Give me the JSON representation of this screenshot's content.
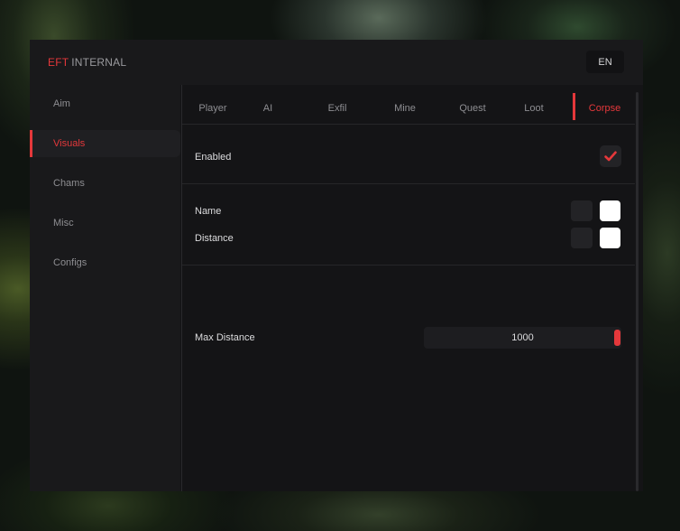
{
  "app": {
    "brand": "EFT",
    "title_rest": "INTERNAL",
    "language": "EN"
  },
  "sidebar": {
    "items": [
      {
        "label": "Aim",
        "active": false
      },
      {
        "label": "Visuals",
        "active": true
      },
      {
        "label": "Chams",
        "active": false
      },
      {
        "label": "Misc",
        "active": false
      },
      {
        "label": "Configs",
        "active": false
      }
    ]
  },
  "tabs": [
    {
      "label": "Player",
      "active": false
    },
    {
      "label": "AI",
      "active": false
    },
    {
      "label": "Exfil",
      "active": false
    },
    {
      "label": "Mine",
      "active": false
    },
    {
      "label": "Quest",
      "active": false
    },
    {
      "label": "Loot",
      "active": false
    },
    {
      "label": "Corpse",
      "active": true
    }
  ],
  "settings": {
    "enabled": {
      "label": "Enabled",
      "checked": true
    },
    "name": {
      "label": "Name",
      "color": "#ffffff"
    },
    "distance": {
      "label": "Distance",
      "color": "#ffffff"
    },
    "max_distance": {
      "label": "Max Distance",
      "value": "1000"
    }
  },
  "colors": {
    "accent": "#e5383b",
    "window_bg": "#141416",
    "panel_bg": "#19191b"
  }
}
